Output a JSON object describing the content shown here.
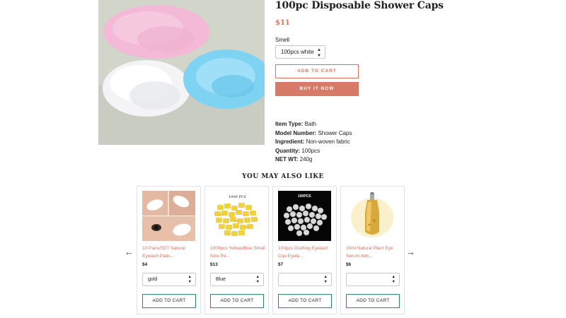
{
  "product": {
    "title": "100pc Disposable Shower Caps",
    "price": "$11",
    "option_label": "Smell",
    "selected_variant": "100pcs white",
    "add_to_cart": "ADD TO CART",
    "buy_now": "BUY IT NOW",
    "specs": [
      {
        "label": "Item Type:",
        "value": "Bath"
      },
      {
        "label": "Model Number:",
        "value": "Shower Caps"
      },
      {
        "label": "Ingredient:",
        "value": "Non-woven fabric"
      },
      {
        "label": "Quantity:",
        "value": "100pcs"
      },
      {
        "label": "NET WT:",
        "value": "240g"
      }
    ]
  },
  "recommendations": {
    "heading": "YOU MAY ALSO LIKE",
    "prev_arrow": "←",
    "next_arrow": "→",
    "items": [
      {
        "title": "10 Pairs/SET Natural Eyelash Pads...",
        "price": "$4",
        "selected": "gold",
        "button": "ADD TO CART"
      },
      {
        "title": "1000pcs Yellow/Blue Small Size Pe...",
        "price": "$13",
        "selected": "Blue",
        "button": "ADD TO CART",
        "image_caption": "1000 PCS"
      },
      {
        "title": "100pcs Grafting Eyelash Cup Eyela...",
        "price": "$7",
        "selected": "",
        "button": "ADD TO CART",
        "image_caption": "100PCS"
      },
      {
        "title": "10ml Natural Plant Eye Serum Anti...",
        "price": "$6",
        "selected": "",
        "button": "ADD TO CART"
      }
    ]
  },
  "icons": {
    "select_arrows": "◆"
  },
  "colors": {
    "accent": "#d6735f",
    "button_border": "#2b8a6b"
  }
}
